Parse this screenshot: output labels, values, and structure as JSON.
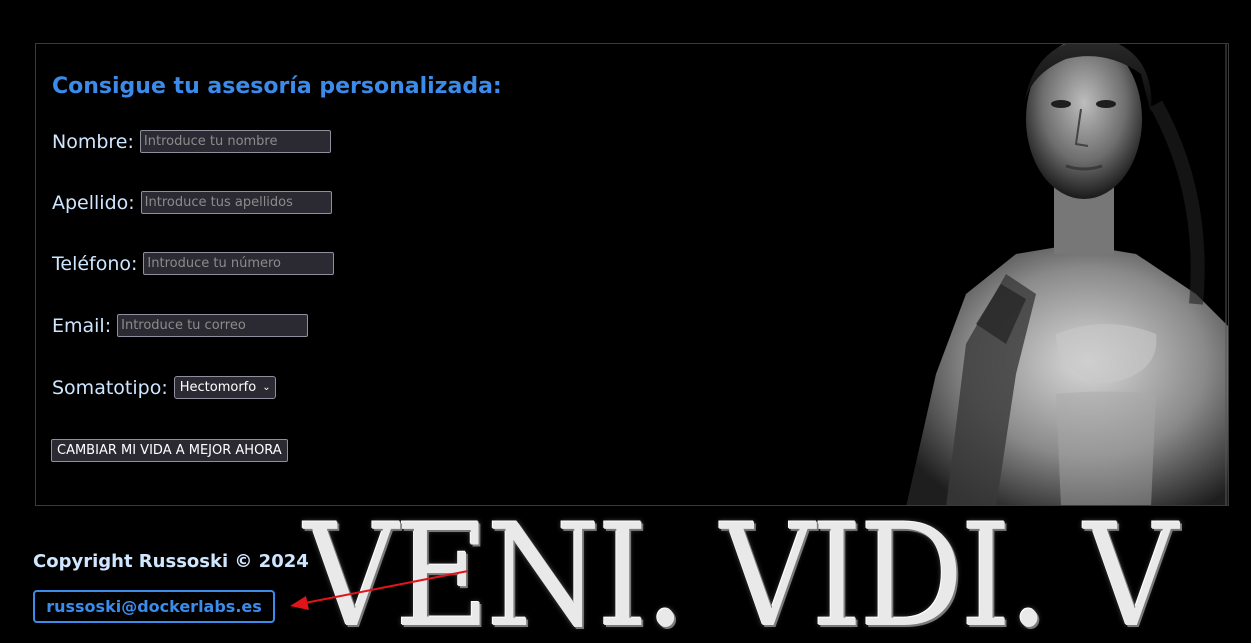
{
  "form": {
    "title": "Consigue tu asesoría personalizada:",
    "fields": [
      {
        "label": "Nombre:",
        "placeholder": "Introduce tu nombre"
      },
      {
        "label": "Apellido:",
        "placeholder": "Introduce tus apellidos"
      },
      {
        "label": "Teléfono:",
        "placeholder": "Introduce tu número"
      },
      {
        "label": "Email:",
        "placeholder": "Introduce tu correo"
      }
    ],
    "somatotype": {
      "label": "Somatotipo:",
      "selected": "Hectomorfo"
    },
    "submit_label": "CAMBIAR MI VIDA A MEJOR AHORA"
  },
  "footer": {
    "copyright": "Copyright Russoski © 2024",
    "email": "russoski@dockerlabs.es"
  },
  "banner": {
    "text": "VENI. VIDI. V"
  },
  "colors": {
    "accent": "#3b8beb",
    "arrow": "#e0141a",
    "background": "#000000"
  },
  "icons": {
    "select": "chevron-down-icon"
  }
}
